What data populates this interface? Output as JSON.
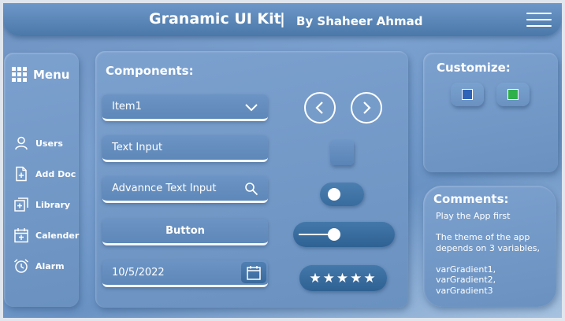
{
  "header": {
    "title": "Granamic UI Kit",
    "separator": "|",
    "author": "By Shaheer Ahmad"
  },
  "menu": {
    "title": "Menu",
    "items": [
      {
        "label": "Users",
        "icon": "user-icon"
      },
      {
        "label": "Add Doc",
        "icon": "add-document-icon"
      },
      {
        "label": "Library",
        "icon": "library-icon"
      },
      {
        "label": "Calender",
        "icon": "calendar-icon"
      },
      {
        "label": "Alarm",
        "icon": "alarm-icon"
      }
    ]
  },
  "components": {
    "title": "Components:",
    "dropdown_value": "Item1",
    "text_input_value": "Text Input",
    "advanced_input_value": "Advannce Text Input",
    "button_label": "Button",
    "date_value": "10/5/2022",
    "toggle_state": "off",
    "slider_value_fraction": 0.37,
    "rating_stars": 5,
    "rating_glyphs": "★★★★★"
  },
  "customize": {
    "title": "Customize:",
    "colors": [
      "#2f63b8",
      "#2fb04a"
    ]
  },
  "comments": {
    "title": "Comments:",
    "lines": [
      "Play the App first",
      "",
      "The theme of the app",
      "depends on 3 variables,",
      "",
      "varGradient1,",
      "varGradient2,",
      "varGradient3"
    ]
  },
  "colors": {
    "panel": "#7399c8",
    "topbar": "#4a78a8",
    "text": "#ffffff"
  }
}
